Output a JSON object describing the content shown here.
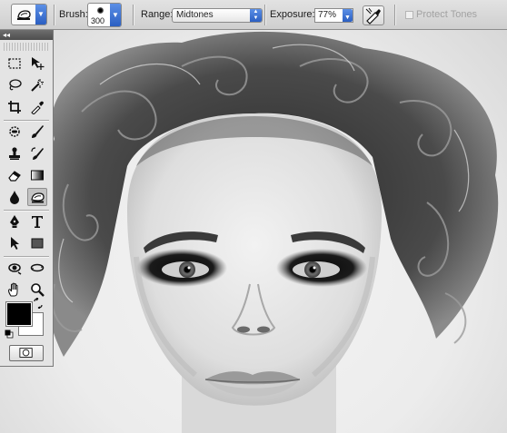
{
  "options_bar": {
    "tool_preset_icon": "sponge-icon",
    "brush_label": "Brush:",
    "brush_size": "300",
    "range_label": "Range:",
    "range_value": "Midtones",
    "exposure_label": "Exposure:",
    "exposure_value": "77%",
    "airbrush_icon": "airbrush-icon",
    "protect_tones_label": "Protect Tones",
    "protect_tones_checked": false
  },
  "toolbox": {
    "collapse_glyph": "◂◂",
    "tools": [
      "rectangular-marquee-icon",
      "move-icon",
      "lasso-icon",
      "magic-wand-icon",
      "crop-icon",
      "eyedropper-icon",
      "spot-healing-icon",
      "brush-icon",
      "clone-stamp-icon",
      "history-brush-icon",
      "eraser-icon",
      "gradient-icon",
      "blur-icon",
      "dodge-icon",
      "pen-icon",
      "type-icon",
      "path-selection-icon",
      "rectangle-shape-icon",
      "rotate-view-icon",
      "3d-orbit-icon",
      "hand-icon",
      "zoom-icon"
    ],
    "active_tool": "dodge-icon",
    "foreground_color": "#000000",
    "background_color": "#ffffff"
  },
  "canvas": {
    "image": "black-and-white-portrait-photo"
  }
}
